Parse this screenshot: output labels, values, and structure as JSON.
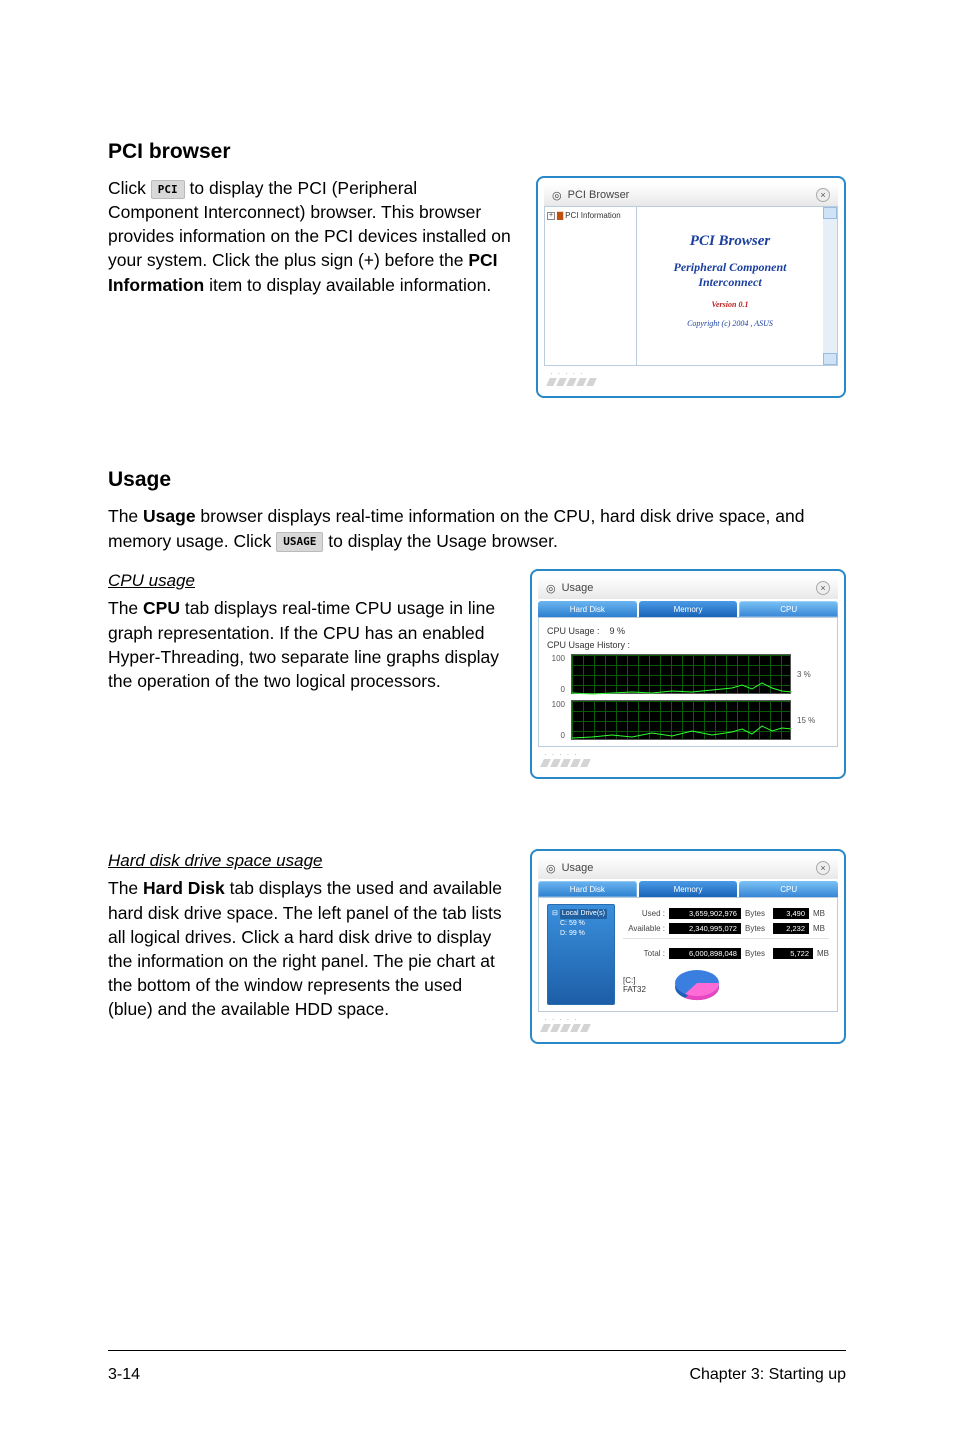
{
  "pci_section": {
    "heading": "PCI browser",
    "para_click": "Click",
    "pci_button": "PCI",
    "para_rest_1": "to display the PCI (Peripheral Component Interconnect) browser. This browser provides information on the PCI devices installed on your system. Click the plus sign (+) before the ",
    "bold_pci_info": "PCI Information",
    "para_rest_2": " item to display available information.",
    "window": {
      "title": "PCI Browser",
      "tree_item": "PCI Information",
      "panel_title": "PCI Browser",
      "panel_sub1": "Peripheral Component",
      "panel_sub2": "Interconnect",
      "version": "Version 0.1",
      "copyright": "Copyright (c) 2004 , ASUS"
    }
  },
  "usage_section": {
    "heading": "Usage",
    "intro_1": "The ",
    "intro_bold": "Usage",
    "intro_2": " browser displays real-time information on the CPU, hard disk drive space, and memory usage. Click ",
    "usage_button": "USAGE",
    "intro_3": " to display the Usage browser.",
    "cpu": {
      "sub_heading": "CPU usage",
      "para_1": "The ",
      "bold": "CPU",
      "para_2": " tab displays real-time CPU usage in line graph representation. If the CPU has an enabled Hyper-Threading, two separate line graphs display the operation of the two logical processors.",
      "window": {
        "title": "Usage",
        "tabs": {
          "hd": "Hard Disk",
          "mem": "Memory",
          "cpu": "CPU"
        },
        "cpu_usage_label": "CPU Usage :",
        "cpu_usage_value": "9   %",
        "cpu_history_label": "CPU Usage History :",
        "y_top": "100",
        "y_bot": "0",
        "pct1": "3 %",
        "pct2": "15 %"
      }
    },
    "hdd": {
      "sub_heading": "Hard disk drive space usage",
      "para_1": "The ",
      "bold": "Hard Disk",
      "para_2": " tab displays the used and available hard disk drive space. The left panel of the tab lists all logical drives. Click a hard disk drive to display the information on the right panel. The pie chart at the bottom of the window represents the used (blue) and the available HDD space.",
      "window": {
        "title": "Usage",
        "tabs": {
          "hd": "Hard Disk",
          "mem": "Memory",
          "cpu": "CPU"
        },
        "drive_header": "Local Drive(s)",
        "drive_c": "C:  59 %",
        "drive_d": "D:  99 %",
        "used_label": "Used :",
        "used_bytes": "3,659,902,976",
        "used_unit": "Bytes",
        "used_mb": "3,490",
        "avail_label": "Available :",
        "avail_bytes": "2,340,995,072",
        "avail_mb": "2,232",
        "total_label": "Total :",
        "total_bytes": "6,000,898,048",
        "total_mb": "5,722",
        "mb_unit": "MB",
        "pie_drive": "[C:]",
        "pie_fs": "FAT32"
      }
    }
  },
  "footer": {
    "left": "3-14",
    "right": "Chapter 3: Starting up"
  },
  "chart_data": [
    {
      "type": "line",
      "title": "CPU Usage History (logical processor 1)",
      "ylim": [
        0,
        100
      ],
      "current_pct": 3,
      "values": [
        2,
        1,
        2,
        3,
        2,
        4,
        3,
        2,
        5,
        4,
        3,
        2,
        6,
        4,
        3,
        2,
        4,
        3,
        5,
        12,
        8,
        6,
        4,
        3
      ]
    },
    {
      "type": "line",
      "title": "CPU Usage History (logical processor 2)",
      "ylim": [
        0,
        100
      ],
      "current_pct": 15,
      "values": [
        4,
        3,
        5,
        4,
        6,
        8,
        5,
        4,
        7,
        6,
        10,
        8,
        6,
        9,
        7,
        5,
        8,
        6,
        10,
        12,
        9,
        18,
        14,
        15
      ]
    },
    {
      "type": "pie",
      "title": "[C:] FAT32",
      "categories": [
        "Used",
        "Available"
      ],
      "values": [
        3659902976,
        2340995072
      ]
    }
  ]
}
